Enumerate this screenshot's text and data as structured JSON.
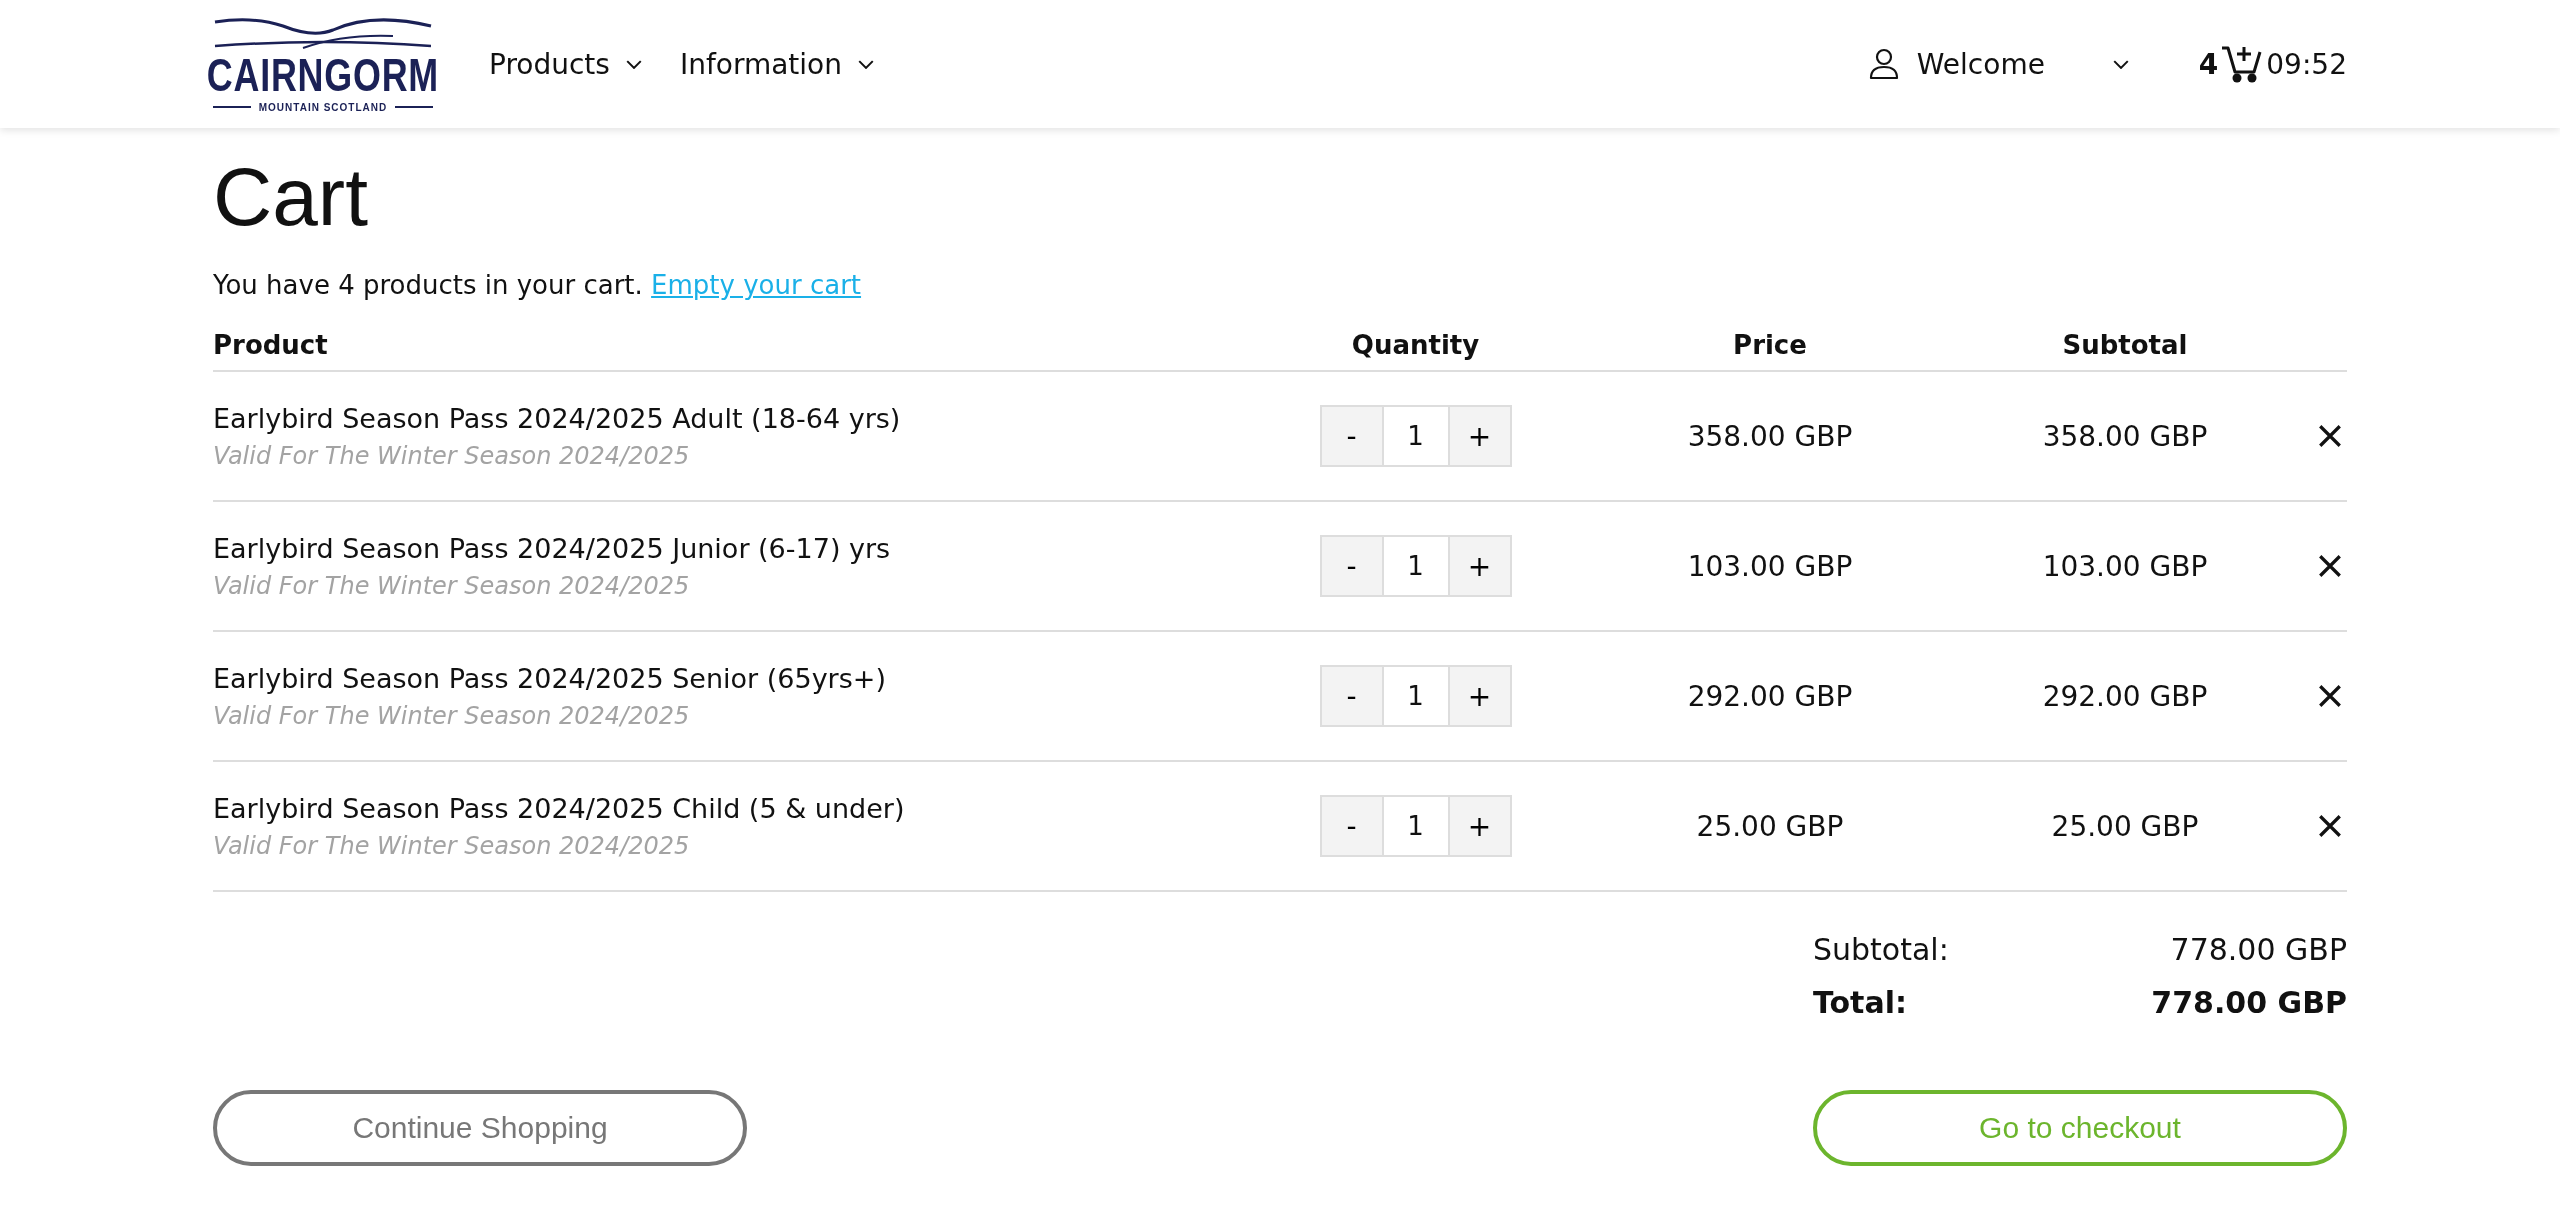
{
  "header": {
    "logo": {
      "name": "CAIRNGORM",
      "tagline": "MOUNTAIN SCOTLAND"
    },
    "nav": [
      {
        "label": "Products"
      },
      {
        "label": "Information"
      }
    ],
    "account": {
      "label": "Welcome"
    },
    "cart": {
      "count": "4",
      "time": "09:52"
    }
  },
  "title": "Cart",
  "summary": {
    "text": "You have 4 products in your cart.",
    "link": "Empty your cart"
  },
  "table": {
    "columns": [
      "Product",
      "Quantity",
      "Price",
      "Subtotal"
    ],
    "rows": [
      {
        "name": "Earlybird Season Pass 2024/2025 Adult (18-64 yrs)",
        "note": "Valid For The Winter Season 2024/2025",
        "minus": "-",
        "quantity": "1",
        "plus": "+",
        "price": "358.00 GBP",
        "subtotal": "358.00 GBP"
      },
      {
        "name": "Earlybird Season Pass 2024/2025 Junior (6-17) yrs",
        "note": "Valid For The Winter Season 2024/2025",
        "minus": "-",
        "quantity": "1",
        "plus": "+",
        "price": "103.00 GBP",
        "subtotal": "103.00 GBP"
      },
      {
        "name": "Earlybird Season Pass 2024/2025 Senior (65yrs+)",
        "note": "Valid For The Winter Season 2024/2025",
        "minus": "-",
        "quantity": "1",
        "plus": "+",
        "price": "292.00 GBP",
        "subtotal": "292.00 GBP"
      },
      {
        "name": "Earlybird Season Pass 2024/2025 Child (5 & under)",
        "note": "Valid For The Winter Season 2024/2025",
        "minus": "-",
        "quantity": "1",
        "plus": "+",
        "price": "25.00 GBP",
        "subtotal": "25.00 GBP"
      }
    ]
  },
  "totals": [
    {
      "label": "Subtotal:",
      "value": "778.00 GBP",
      "kind": "normal"
    },
    {
      "label": "Total:",
      "value": "778.00 GBP",
      "kind": "strong"
    }
  ],
  "buttons": [
    {
      "label": "Continue Shopping",
      "kind": "secondary"
    },
    {
      "label": "Go to checkout",
      "kind": "primary"
    }
  ]
}
